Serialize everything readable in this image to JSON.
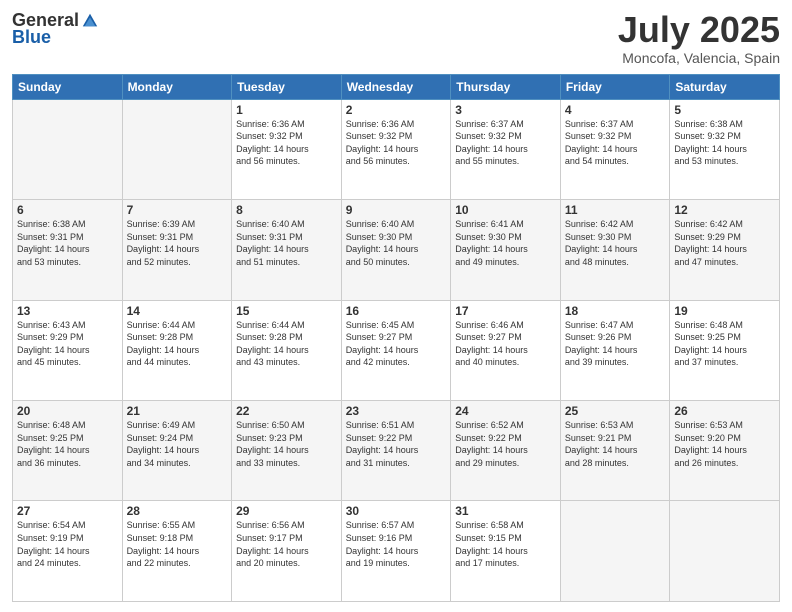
{
  "header": {
    "logo_general": "General",
    "logo_blue": "Blue",
    "month_title": "July 2025",
    "location": "Moncofa, Valencia, Spain"
  },
  "weekdays": [
    "Sunday",
    "Monday",
    "Tuesday",
    "Wednesday",
    "Thursday",
    "Friday",
    "Saturday"
  ],
  "weeks": [
    [
      {
        "day": "",
        "info": ""
      },
      {
        "day": "",
        "info": ""
      },
      {
        "day": "1",
        "info": "Sunrise: 6:36 AM\nSunset: 9:32 PM\nDaylight: 14 hours\nand 56 minutes."
      },
      {
        "day": "2",
        "info": "Sunrise: 6:36 AM\nSunset: 9:32 PM\nDaylight: 14 hours\nand 56 minutes."
      },
      {
        "day": "3",
        "info": "Sunrise: 6:37 AM\nSunset: 9:32 PM\nDaylight: 14 hours\nand 55 minutes."
      },
      {
        "day": "4",
        "info": "Sunrise: 6:37 AM\nSunset: 9:32 PM\nDaylight: 14 hours\nand 54 minutes."
      },
      {
        "day": "5",
        "info": "Sunrise: 6:38 AM\nSunset: 9:32 PM\nDaylight: 14 hours\nand 53 minutes."
      }
    ],
    [
      {
        "day": "6",
        "info": "Sunrise: 6:38 AM\nSunset: 9:31 PM\nDaylight: 14 hours\nand 53 minutes."
      },
      {
        "day": "7",
        "info": "Sunrise: 6:39 AM\nSunset: 9:31 PM\nDaylight: 14 hours\nand 52 minutes."
      },
      {
        "day": "8",
        "info": "Sunrise: 6:40 AM\nSunset: 9:31 PM\nDaylight: 14 hours\nand 51 minutes."
      },
      {
        "day": "9",
        "info": "Sunrise: 6:40 AM\nSunset: 9:30 PM\nDaylight: 14 hours\nand 50 minutes."
      },
      {
        "day": "10",
        "info": "Sunrise: 6:41 AM\nSunset: 9:30 PM\nDaylight: 14 hours\nand 49 minutes."
      },
      {
        "day": "11",
        "info": "Sunrise: 6:42 AM\nSunset: 9:30 PM\nDaylight: 14 hours\nand 48 minutes."
      },
      {
        "day": "12",
        "info": "Sunrise: 6:42 AM\nSunset: 9:29 PM\nDaylight: 14 hours\nand 47 minutes."
      }
    ],
    [
      {
        "day": "13",
        "info": "Sunrise: 6:43 AM\nSunset: 9:29 PM\nDaylight: 14 hours\nand 45 minutes."
      },
      {
        "day": "14",
        "info": "Sunrise: 6:44 AM\nSunset: 9:28 PM\nDaylight: 14 hours\nand 44 minutes."
      },
      {
        "day": "15",
        "info": "Sunrise: 6:44 AM\nSunset: 9:28 PM\nDaylight: 14 hours\nand 43 minutes."
      },
      {
        "day": "16",
        "info": "Sunrise: 6:45 AM\nSunset: 9:27 PM\nDaylight: 14 hours\nand 42 minutes."
      },
      {
        "day": "17",
        "info": "Sunrise: 6:46 AM\nSunset: 9:27 PM\nDaylight: 14 hours\nand 40 minutes."
      },
      {
        "day": "18",
        "info": "Sunrise: 6:47 AM\nSunset: 9:26 PM\nDaylight: 14 hours\nand 39 minutes."
      },
      {
        "day": "19",
        "info": "Sunrise: 6:48 AM\nSunset: 9:25 PM\nDaylight: 14 hours\nand 37 minutes."
      }
    ],
    [
      {
        "day": "20",
        "info": "Sunrise: 6:48 AM\nSunset: 9:25 PM\nDaylight: 14 hours\nand 36 minutes."
      },
      {
        "day": "21",
        "info": "Sunrise: 6:49 AM\nSunset: 9:24 PM\nDaylight: 14 hours\nand 34 minutes."
      },
      {
        "day": "22",
        "info": "Sunrise: 6:50 AM\nSunset: 9:23 PM\nDaylight: 14 hours\nand 33 minutes."
      },
      {
        "day": "23",
        "info": "Sunrise: 6:51 AM\nSunset: 9:22 PM\nDaylight: 14 hours\nand 31 minutes."
      },
      {
        "day": "24",
        "info": "Sunrise: 6:52 AM\nSunset: 9:22 PM\nDaylight: 14 hours\nand 29 minutes."
      },
      {
        "day": "25",
        "info": "Sunrise: 6:53 AM\nSunset: 9:21 PM\nDaylight: 14 hours\nand 28 minutes."
      },
      {
        "day": "26",
        "info": "Sunrise: 6:53 AM\nSunset: 9:20 PM\nDaylight: 14 hours\nand 26 minutes."
      }
    ],
    [
      {
        "day": "27",
        "info": "Sunrise: 6:54 AM\nSunset: 9:19 PM\nDaylight: 14 hours\nand 24 minutes."
      },
      {
        "day": "28",
        "info": "Sunrise: 6:55 AM\nSunset: 9:18 PM\nDaylight: 14 hours\nand 22 minutes."
      },
      {
        "day": "29",
        "info": "Sunrise: 6:56 AM\nSunset: 9:17 PM\nDaylight: 14 hours\nand 20 minutes."
      },
      {
        "day": "30",
        "info": "Sunrise: 6:57 AM\nSunset: 9:16 PM\nDaylight: 14 hours\nand 19 minutes."
      },
      {
        "day": "31",
        "info": "Sunrise: 6:58 AM\nSunset: 9:15 PM\nDaylight: 14 hours\nand 17 minutes."
      },
      {
        "day": "",
        "info": ""
      },
      {
        "day": "",
        "info": ""
      }
    ]
  ]
}
